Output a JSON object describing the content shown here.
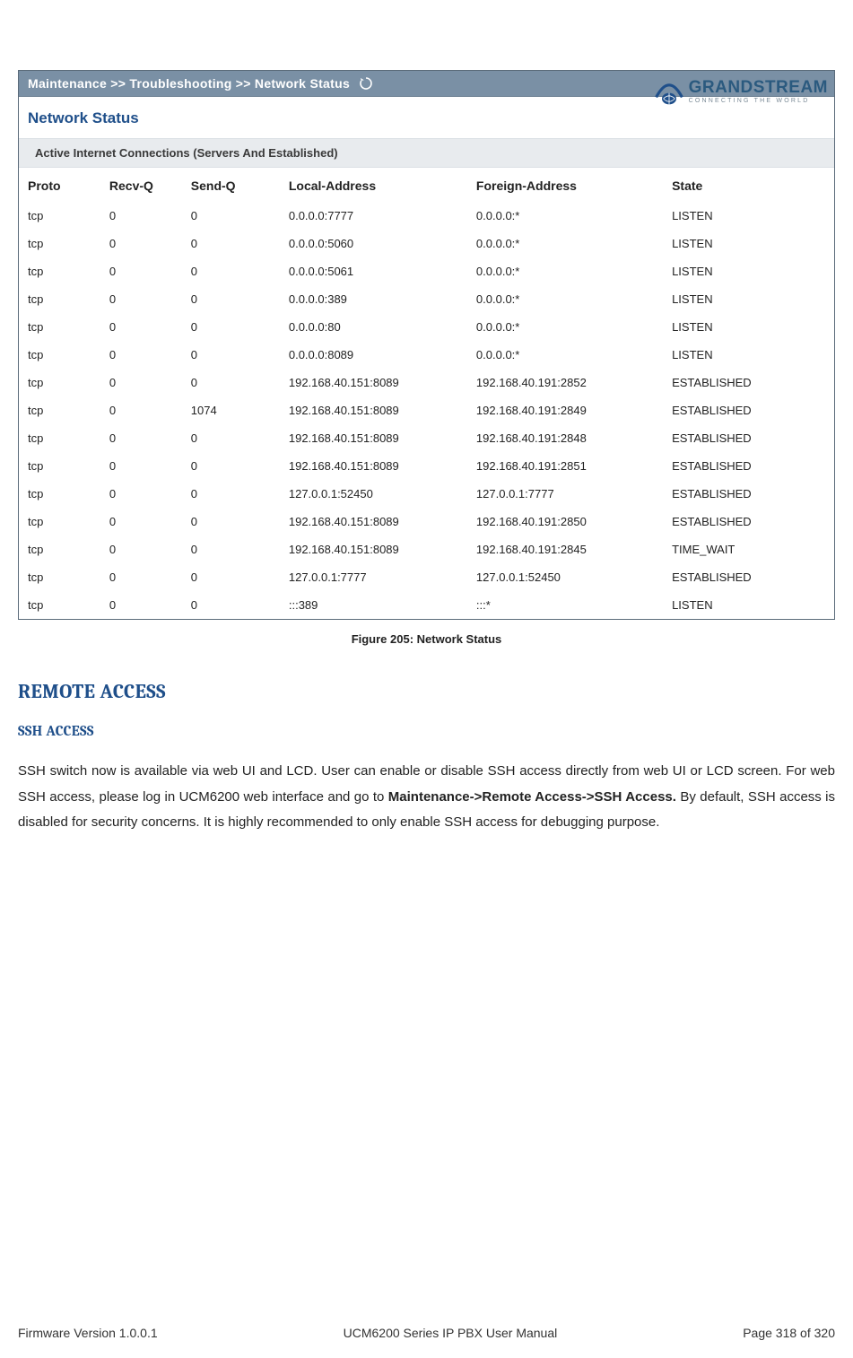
{
  "brand": {
    "name": "GRANDSTREAM",
    "tagline": "CONNECTING THE WORLD"
  },
  "screenshot": {
    "breadcrumb": "Maintenance >> Troubleshooting >> Network Status",
    "section_title": "Network Status",
    "sub_band": "Active Internet Connections (Servers And Established)",
    "columns": {
      "proto": "Proto",
      "recvq": "Recv-Q",
      "sendq": "Send-Q",
      "local": "Local-Address",
      "foreign": "Foreign-Address",
      "state": "State"
    },
    "rows": [
      {
        "proto": "tcp",
        "recvq": "0",
        "sendq": "0",
        "local": "0.0.0.0:7777",
        "foreign": "0.0.0.0:*",
        "state": "LISTEN"
      },
      {
        "proto": "tcp",
        "recvq": "0",
        "sendq": "0",
        "local": "0.0.0.0:5060",
        "foreign": "0.0.0.0:*",
        "state": "LISTEN"
      },
      {
        "proto": "tcp",
        "recvq": "0",
        "sendq": "0",
        "local": "0.0.0.0:5061",
        "foreign": "0.0.0.0:*",
        "state": "LISTEN"
      },
      {
        "proto": "tcp",
        "recvq": "0",
        "sendq": "0",
        "local": "0.0.0.0:389",
        "foreign": "0.0.0.0:*",
        "state": "LISTEN"
      },
      {
        "proto": "tcp",
        "recvq": "0",
        "sendq": "0",
        "local": "0.0.0.0:80",
        "foreign": "0.0.0.0:*",
        "state": "LISTEN"
      },
      {
        "proto": "tcp",
        "recvq": "0",
        "sendq": "0",
        "local": "0.0.0.0:8089",
        "foreign": "0.0.0.0:*",
        "state": "LISTEN"
      },
      {
        "proto": "tcp",
        "recvq": "0",
        "sendq": "0",
        "local": "192.168.40.151:8089",
        "foreign": "192.168.40.191:2852",
        "state": "ESTABLISHED"
      },
      {
        "proto": "tcp",
        "recvq": "0",
        "sendq": "1074",
        "local": "192.168.40.151:8089",
        "foreign": "192.168.40.191:2849",
        "state": "ESTABLISHED"
      },
      {
        "proto": "tcp",
        "recvq": "0",
        "sendq": "0",
        "local": "192.168.40.151:8089",
        "foreign": "192.168.40.191:2848",
        "state": "ESTABLISHED"
      },
      {
        "proto": "tcp",
        "recvq": "0",
        "sendq": "0",
        "local": "192.168.40.151:8089",
        "foreign": "192.168.40.191:2851",
        "state": "ESTABLISHED"
      },
      {
        "proto": "tcp",
        "recvq": "0",
        "sendq": "0",
        "local": "127.0.0.1:52450",
        "foreign": "127.0.0.1:7777",
        "state": "ESTABLISHED"
      },
      {
        "proto": "tcp",
        "recvq": "0",
        "sendq": "0",
        "local": "192.168.40.151:8089",
        "foreign": "192.168.40.191:2850",
        "state": "ESTABLISHED"
      },
      {
        "proto": "tcp",
        "recvq": "0",
        "sendq": "0",
        "local": "192.168.40.151:8089",
        "foreign": "192.168.40.191:2845",
        "state": "TIME_WAIT"
      },
      {
        "proto": "tcp",
        "recvq": "0",
        "sendq": "0",
        "local": "127.0.0.1:7777",
        "foreign": "127.0.0.1:52450",
        "state": "ESTABLISHED"
      },
      {
        "proto": "tcp",
        "recvq": "0",
        "sendq": "0",
        "local": ":::389",
        "foreign": ":::*",
        "state": "LISTEN"
      }
    ]
  },
  "caption": "Figure 205: Network Status",
  "headings": {
    "remote_access": "REMOTE ACCESS",
    "ssh_access": "SSH ACCESS"
  },
  "paragraph": {
    "pre": "SSH switch now is available via web UI and LCD. User can enable or disable SSH access directly from web UI or LCD screen. For web SSH access, please log in UCM6200 web interface and go to ",
    "bold": "Maintenance->Remote Access->SSH Access.",
    "post": " By default, SSH access is disabled for security concerns. It is highly recommended to only enable SSH access for debugging purpose."
  },
  "footer": {
    "left": "Firmware Version 1.0.0.1",
    "center": "UCM6200 Series IP PBX User Manual",
    "right": "Page 318 of 320"
  }
}
